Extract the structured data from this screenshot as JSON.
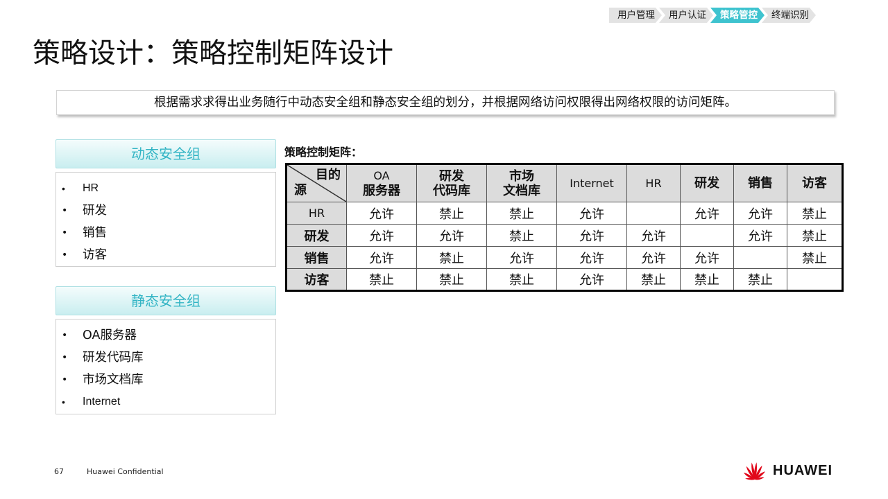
{
  "breadcrumb": [
    "用户管理",
    "用户认证",
    "策略管控",
    "终端识别"
  ],
  "title": "策略设计：策略控制矩阵设计",
  "summary": "根据需求求得出业务随行中动态安全组和静态安全组的划分，并根据网络访问权限得出网络权限的访问矩阵。",
  "dynamic_group": {
    "header": "动态安全组",
    "items": [
      "HR",
      "研发",
      "销售",
      "访客"
    ]
  },
  "static_group": {
    "header": "静态安全组",
    "items": [
      "OA服务器",
      "研发代码库",
      "市场文档库",
      "Internet"
    ]
  },
  "matrix": {
    "title": "策略控制矩阵：",
    "corner_dest": "目的",
    "corner_src": "源",
    "columns": [
      [
        "OA",
        "服务器"
      ],
      [
        "研发",
        "代码库"
      ],
      [
        "市场",
        "文档库"
      ],
      [
        "Internet"
      ],
      [
        "HR"
      ],
      [
        "研发"
      ],
      [
        "销售"
      ],
      [
        "访客"
      ]
    ],
    "rows": [
      {
        "source": "HR",
        "cells": [
          "允许",
          "禁止",
          "禁止",
          "允许",
          "",
          "允许",
          "允许",
          "禁止"
        ]
      },
      {
        "source": "研发",
        "cells": [
          "允许",
          "允许",
          "禁止",
          "允许",
          "允许",
          "",
          "允许",
          "禁止"
        ]
      },
      {
        "source": "销售",
        "cells": [
          "允许",
          "禁止",
          "允许",
          "允许",
          "允许",
          "允许",
          "",
          "禁止"
        ]
      },
      {
        "source": "访客",
        "cells": [
          "禁止",
          "禁止",
          "禁止",
          "允许",
          "禁止",
          "禁止",
          "禁止",
          ""
        ]
      }
    ]
  },
  "footer": {
    "page_number": "67",
    "confidential": "Huawei Confidential",
    "brand": "HUAWEI"
  },
  "colors": {
    "accent": "#3ec3cf",
    "group_text": "#32b4c4",
    "brand_red": "#e1061a"
  }
}
